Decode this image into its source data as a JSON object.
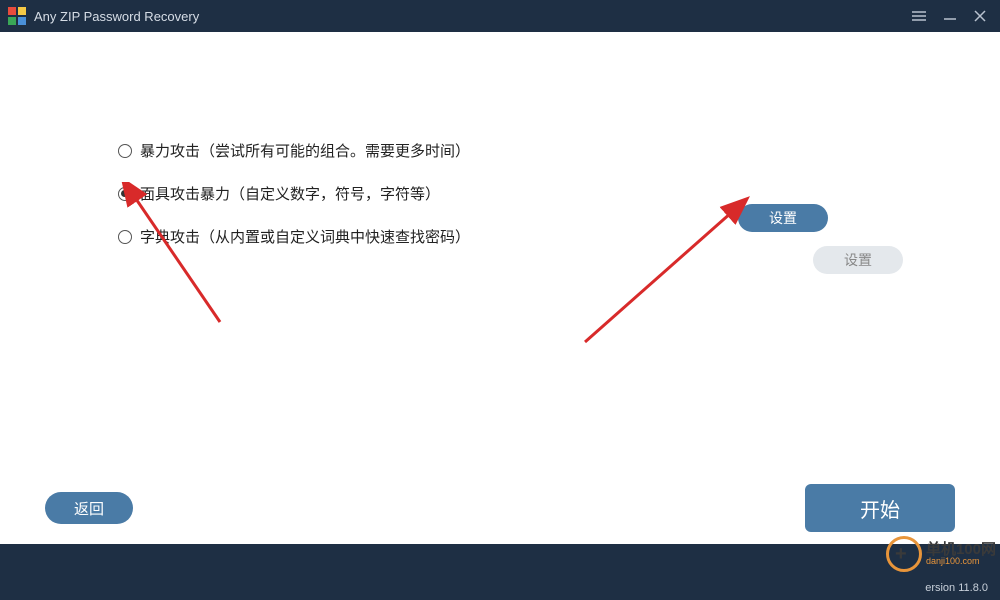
{
  "titlebar": {
    "title": "Any ZIP Password Recovery"
  },
  "options": {
    "brute_force": "暴力攻击（尝试所有可能的组合。需要更多时间）",
    "mask": "面具攻击暴力（自定义数字，符号，字符等）",
    "dictionary": "字典攻击（从内置或自定义词典中快速查找密码）",
    "selected": "mask"
  },
  "buttons": {
    "settings_active": "设置",
    "settings_disabled": "设置",
    "back": "返回",
    "start": "开始"
  },
  "footer": {
    "version": "ersion 11.8.0"
  },
  "watermark": {
    "text_top": "单机100网",
    "text_bottom": "danji100.com"
  },
  "colors": {
    "titlebar_bg": "#1e2f44",
    "button_primary": "#4a7ba6",
    "button_disabled": "#e4e8ec",
    "arrow": "#d82a2a"
  }
}
